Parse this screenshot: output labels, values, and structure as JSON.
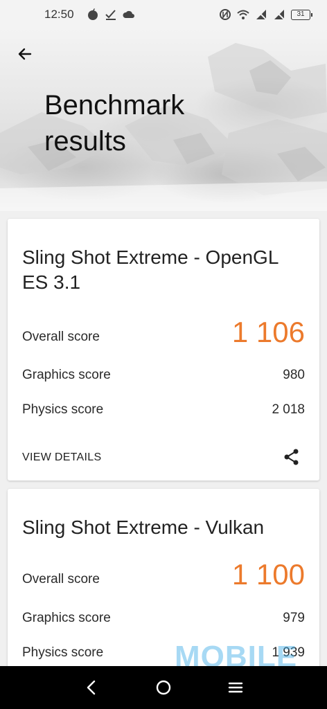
{
  "status_bar": {
    "time": "12:50",
    "battery": "31",
    "left_icons": [
      "app-notification-icon",
      "check-icon",
      "cloud-icon"
    ],
    "right_icons": [
      "nfc-icon",
      "wifi-icon",
      "no-signal-icon",
      "no-signal-icon",
      "battery-icon"
    ]
  },
  "header": {
    "title": "Benchmark results"
  },
  "cards": [
    {
      "title": "Sling Shot Extreme - OpenGL ES 3.1",
      "overall_label": "Overall score",
      "overall_value": "1 106",
      "graphics_label": "Graphics score",
      "graphics_value": "980",
      "physics_label": "Physics score",
      "physics_value": "2 018",
      "details_label": "VIEW DETAILS"
    },
    {
      "title": "Sling Shot Extreme - Vulkan",
      "overall_label": "Overall score",
      "overall_value": "1 100",
      "graphics_label": "Graphics score",
      "graphics_value": "979",
      "physics_label": "Physics score",
      "physics_value": "1 939"
    }
  ],
  "watermark": "MOBILE",
  "colors": {
    "accent": "#ec7a2c",
    "nav_bar": "#000000",
    "watermark": "#3caae6"
  }
}
